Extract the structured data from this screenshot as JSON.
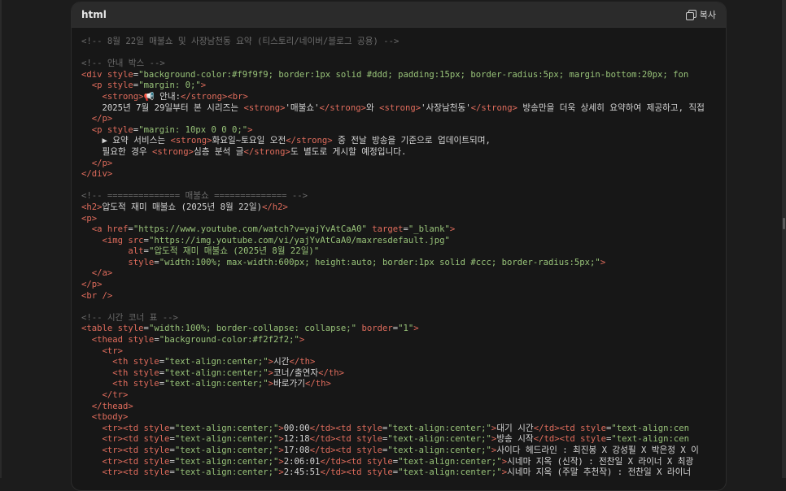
{
  "header": {
    "language": "html",
    "copy_label": "복사"
  },
  "code_lines": [
    [
      [
        "c",
        "<!-- 8월 22일 매불쇼 및 사장남천동 요약 (티스토리/네이버/블로그 공용) -->"
      ]
    ],
    [],
    [
      [
        "c",
        "<!-- 안내 박스 -->"
      ]
    ],
    [
      [
        "t",
        "<div "
      ],
      [
        "a",
        "style"
      ],
      [
        "p",
        "="
      ],
      [
        "s",
        "\"background-color:#f9f9f9; border:1px solid #ddd; padding:15px; border-radius:5px; margin-bottom:20px; fon"
      ]
    ],
    [
      [
        "p",
        "  "
      ],
      [
        "t",
        "<p "
      ],
      [
        "a",
        "style"
      ],
      [
        "p",
        "="
      ],
      [
        "s",
        "\"margin: 0;\""
      ],
      [
        "t",
        ">"
      ]
    ],
    [
      [
        "p",
        "    "
      ],
      [
        "t",
        "<strong>"
      ],
      [
        "x",
        "📢 안내:"
      ],
      [
        "t",
        "</strong>"
      ],
      [
        "t",
        "<br>"
      ]
    ],
    [
      [
        "x",
        "    2025년 7월 29일부터 본 시리즈는 "
      ],
      [
        "t",
        "<strong>"
      ],
      [
        "x",
        "'매불쇼'"
      ],
      [
        "t",
        "</strong>"
      ],
      [
        "x",
        "와 "
      ],
      [
        "t",
        "<strong>"
      ],
      [
        "x",
        "'사장남천동'"
      ],
      [
        "t",
        "</strong>"
      ],
      [
        "x",
        " 방송만을 더욱 상세히 요약하여 제공하고, 직접"
      ]
    ],
    [
      [
        "p",
        "  "
      ],
      [
        "t",
        "</p>"
      ]
    ],
    [
      [
        "p",
        "  "
      ],
      [
        "t",
        "<p "
      ],
      [
        "a",
        "style"
      ],
      [
        "p",
        "="
      ],
      [
        "s",
        "\"margin: 10px 0 0 0;\""
      ],
      [
        "t",
        ">"
      ]
    ],
    [
      [
        "x",
        "    ▶ 요약 서비스는 "
      ],
      [
        "t",
        "<strong>"
      ],
      [
        "x",
        "화요일~토요일 오전"
      ],
      [
        "t",
        "</strong>"
      ],
      [
        "x",
        " 중 전날 방송을 기준으로 업데이트되며,"
      ]
    ],
    [
      [
        "x",
        "    필요한 경우 "
      ],
      [
        "t",
        "<strong>"
      ],
      [
        "x",
        "심층 분석 글"
      ],
      [
        "t",
        "</strong>"
      ],
      [
        "x",
        "도 별도로 게시할 예정입니다."
      ]
    ],
    [
      [
        "p",
        "  "
      ],
      [
        "t",
        "</p>"
      ]
    ],
    [
      [
        "t",
        "</div>"
      ]
    ],
    [],
    [
      [
        "c",
        "<!-- ============== 매불쇼 ============== -->"
      ]
    ],
    [
      [
        "t",
        "<h2>"
      ],
      [
        "x",
        "압도적 재미 매불쇼 (2025년 8월 22일)"
      ],
      [
        "t",
        "</h2>"
      ]
    ],
    [
      [
        "t",
        "<p>"
      ]
    ],
    [
      [
        "p",
        "  "
      ],
      [
        "t",
        "<a "
      ],
      [
        "a",
        "href"
      ],
      [
        "p",
        "="
      ],
      [
        "s",
        "\"https://www.youtube.com/watch?v=yajYvAtCaA0\""
      ],
      [
        "p",
        " "
      ],
      [
        "a",
        "target"
      ],
      [
        "p",
        "="
      ],
      [
        "s",
        "\"_blank\""
      ],
      [
        "t",
        ">"
      ]
    ],
    [
      [
        "p",
        "    "
      ],
      [
        "t",
        "<img "
      ],
      [
        "a",
        "src"
      ],
      [
        "p",
        "="
      ],
      [
        "s",
        "\"https://img.youtube.com/vi/yajYvAtCaA0/maxresdefault.jpg\""
      ]
    ],
    [
      [
        "p",
        "         "
      ],
      [
        "a",
        "alt"
      ],
      [
        "p",
        "="
      ],
      [
        "s",
        "\"압도적 재미 매불쇼 (2025년 8월 22일)\""
      ]
    ],
    [
      [
        "p",
        "         "
      ],
      [
        "a",
        "style"
      ],
      [
        "p",
        "="
      ],
      [
        "s",
        "\"width:100%; max-width:600px; height:auto; border:1px solid #ccc; border-radius:5px;\""
      ],
      [
        "t",
        ">"
      ]
    ],
    [
      [
        "p",
        "  "
      ],
      [
        "t",
        "</a>"
      ]
    ],
    [
      [
        "t",
        "</p>"
      ]
    ],
    [
      [
        "t",
        "<br />"
      ]
    ],
    [],
    [
      [
        "c",
        "<!-- 시간 코너 표 -->"
      ]
    ],
    [
      [
        "t",
        "<table "
      ],
      [
        "a",
        "style"
      ],
      [
        "p",
        "="
      ],
      [
        "s",
        "\"width:100%; border-collapse: collapse;\""
      ],
      [
        "p",
        " "
      ],
      [
        "a",
        "border"
      ],
      [
        "p",
        "="
      ],
      [
        "s",
        "\"1\""
      ],
      [
        "t",
        ">"
      ]
    ],
    [
      [
        "p",
        "  "
      ],
      [
        "t",
        "<thead "
      ],
      [
        "a",
        "style"
      ],
      [
        "p",
        "="
      ],
      [
        "s",
        "\"background-color:#f2f2f2;\""
      ],
      [
        "t",
        ">"
      ]
    ],
    [
      [
        "p",
        "    "
      ],
      [
        "t",
        "<tr>"
      ]
    ],
    [
      [
        "p",
        "      "
      ],
      [
        "t",
        "<th "
      ],
      [
        "a",
        "style"
      ],
      [
        "p",
        "="
      ],
      [
        "s",
        "\"text-align:center;\""
      ],
      [
        "t",
        ">"
      ],
      [
        "x",
        "시간"
      ],
      [
        "t",
        "</th>"
      ]
    ],
    [
      [
        "p",
        "      "
      ],
      [
        "t",
        "<th "
      ],
      [
        "a",
        "style"
      ],
      [
        "p",
        "="
      ],
      [
        "s",
        "\"text-align:center;\""
      ],
      [
        "t",
        ">"
      ],
      [
        "x",
        "코너/출연자"
      ],
      [
        "t",
        "</th>"
      ]
    ],
    [
      [
        "p",
        "      "
      ],
      [
        "t",
        "<th "
      ],
      [
        "a",
        "style"
      ],
      [
        "p",
        "="
      ],
      [
        "s",
        "\"text-align:center;\""
      ],
      [
        "t",
        ">"
      ],
      [
        "x",
        "바로가기"
      ],
      [
        "t",
        "</th>"
      ]
    ],
    [
      [
        "p",
        "    "
      ],
      [
        "t",
        "</tr>"
      ]
    ],
    [
      [
        "p",
        "  "
      ],
      [
        "t",
        "</thead>"
      ]
    ],
    [
      [
        "p",
        "  "
      ],
      [
        "t",
        "<tbody>"
      ]
    ],
    [
      [
        "p",
        "    "
      ],
      [
        "t",
        "<tr><td "
      ],
      [
        "a",
        "style"
      ],
      [
        "p",
        "="
      ],
      [
        "s",
        "\"text-align:center;\""
      ],
      [
        "t",
        ">"
      ],
      [
        "x",
        "00:00"
      ],
      [
        "t",
        "</td><td "
      ],
      [
        "a",
        "style"
      ],
      [
        "p",
        "="
      ],
      [
        "s",
        "\"text-align:center;\""
      ],
      [
        "t",
        ">"
      ],
      [
        "x",
        "대기 시간"
      ],
      [
        "t",
        "</td><td "
      ],
      [
        "a",
        "style"
      ],
      [
        "p",
        "="
      ],
      [
        "s",
        "\"text-align:cen"
      ]
    ],
    [
      [
        "p",
        "    "
      ],
      [
        "t",
        "<tr><td "
      ],
      [
        "a",
        "style"
      ],
      [
        "p",
        "="
      ],
      [
        "s",
        "\"text-align:center;\""
      ],
      [
        "t",
        ">"
      ],
      [
        "x",
        "12:18"
      ],
      [
        "t",
        "</td><td "
      ],
      [
        "a",
        "style"
      ],
      [
        "p",
        "="
      ],
      [
        "s",
        "\"text-align:center;\""
      ],
      [
        "t",
        ">"
      ],
      [
        "x",
        "방송 시작"
      ],
      [
        "t",
        "</td><td "
      ],
      [
        "a",
        "style"
      ],
      [
        "p",
        "="
      ],
      [
        "s",
        "\"text-align:cen"
      ]
    ],
    [
      [
        "p",
        "    "
      ],
      [
        "t",
        "<tr><td "
      ],
      [
        "a",
        "style"
      ],
      [
        "p",
        "="
      ],
      [
        "s",
        "\"text-align:center;\""
      ],
      [
        "t",
        ">"
      ],
      [
        "x",
        "17:08"
      ],
      [
        "t",
        "</td><td "
      ],
      [
        "a",
        "style"
      ],
      [
        "p",
        "="
      ],
      [
        "s",
        "\"text-align:center;\""
      ],
      [
        "t",
        ">"
      ],
      [
        "x",
        "사이다 헤드라인 : 최진봉 X 강성필 X 박은정 X 이"
      ]
    ],
    [
      [
        "p",
        "    "
      ],
      [
        "t",
        "<tr><td "
      ],
      [
        "a",
        "style"
      ],
      [
        "p",
        "="
      ],
      [
        "s",
        "\"text-align:center;\""
      ],
      [
        "t",
        ">"
      ],
      [
        "x",
        "2:06:01"
      ],
      [
        "t",
        "</td><td "
      ],
      [
        "a",
        "style"
      ],
      [
        "p",
        "="
      ],
      [
        "s",
        "\"text-align:center;\""
      ],
      [
        "t",
        ">"
      ],
      [
        "x",
        "시네마 지옥 (신작) : 전찬일 X 라이너 X 최광"
      ]
    ],
    [
      [
        "p",
        "    "
      ],
      [
        "t",
        "<tr><td "
      ],
      [
        "a",
        "style"
      ],
      [
        "p",
        "="
      ],
      [
        "s",
        "\"text-align:center;\""
      ],
      [
        "t",
        ">"
      ],
      [
        "x",
        "2:45:51"
      ],
      [
        "t",
        "</td><td "
      ],
      [
        "a",
        "style"
      ],
      [
        "p",
        "="
      ],
      [
        "s",
        "\"text-align:center;\""
      ],
      [
        "t",
        ">"
      ],
      [
        "x",
        "시네마 지옥 (주말 추천작) : 전찬일 X 라이너"
      ]
    ]
  ]
}
